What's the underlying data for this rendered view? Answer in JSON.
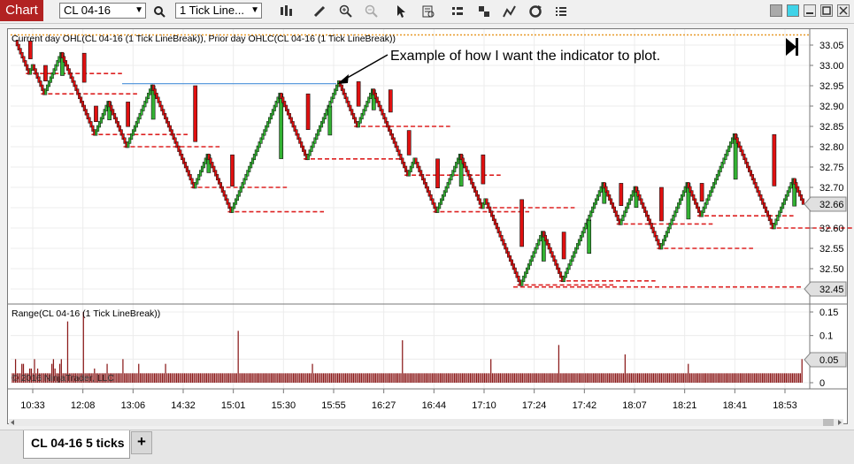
{
  "toolbar": {
    "chart_tab": "Chart",
    "instrument": "CL 04-16",
    "bar_type": "1 Tick Line...",
    "icons": [
      "search-icon",
      "bar-style-icon",
      "pencil-icon",
      "zoom-in-icon",
      "zoom-out-icon",
      "pointer-icon",
      "data-box-icon",
      "properties-icon",
      "strategies-icon",
      "indicators-icon",
      "refresh-icon",
      "menu-icon"
    ]
  },
  "price_panel": {
    "indicator_label": "Current day OHL(CL 04-16 (1 Tick LineBreak)), Prior day OHLC(CL 04-16 (1 Tick LineBreak))",
    "annotation": "Example of how I want the indicator to plot.",
    "y_ticks": [
      "33.05",
      "33.00",
      "32.95",
      "32.90",
      "32.85",
      "32.80",
      "32.75",
      "32.70",
      "32.65",
      "32.60",
      "32.55",
      "32.50",
      "32.45"
    ],
    "last_price": "32.66",
    "low_marker": "32.45"
  },
  "range_panel": {
    "label": "Range(CL 04-16 (1 Tick LineBreak))",
    "y_ticks": [
      "0.15",
      "0.1",
      "0.05",
      "0"
    ],
    "current_value": "0.05",
    "copyright": "© 2016 NinjaTrader, LLC"
  },
  "x_axis": [
    "10:33",
    "12:08",
    "13:06",
    "14:32",
    "15:01",
    "15:30",
    "15:55",
    "16:27",
    "16:44",
    "17:10",
    "17:24",
    "17:42",
    "18:07",
    "18:21",
    "18:41",
    "18:53"
  ],
  "colors": {
    "up": "#33b233",
    "down": "#e01010",
    "panel_border": "#777777",
    "low_line": "#dd2222",
    "annot_line": "#4a90d9",
    "prior_dotted": "#e89a2a",
    "range_bars": "#8b1a1a",
    "chart_tab": "#b22222"
  },
  "tabs": {
    "active": "CL 04-16 5 ticks",
    "add": "+"
  },
  "chart_data": {
    "type": "line-break",
    "price_path": [
      33.06,
      32.98,
      33.0,
      32.93,
      33.03,
      32.9,
      32.83,
      32.91,
      32.8,
      32.95,
      32.7,
      32.78,
      32.64,
      32.93,
      32.77,
      32.9,
      32.96,
      32.85,
      32.94,
      32.84,
      32.73,
      32.77,
      32.64,
      32.78,
      32.65,
      32.67,
      32.46,
      32.59,
      32.47,
      32.62,
      32.71,
      32.61,
      32.7,
      32.55,
      32.71,
      32.63,
      32.83,
      32.6,
      32.72,
      32.66
    ],
    "range_values": [
      0.02,
      0.02,
      0.05,
      0.02,
      0.02,
      0.02,
      0.04,
      0.04,
      0.02,
      0.02,
      0.02,
      0.03,
      0.03,
      0.02,
      0.05,
      0.02,
      0.03,
      0.02,
      0.02,
      0.02,
      0.02,
      0.02,
      0.02,
      0.02,
      0.02,
      0.04,
      0.05,
      0.03,
      0.02,
      0.02,
      0.04,
      0.05,
      0.02,
      0.02,
      0.02,
      0.13,
      0.02,
      0.02,
      0.02,
      0.02,
      0.02,
      0.02,
      0.02,
      0.02,
      0.02,
      0.15,
      0.02,
      0.02,
      0.02,
      0.02,
      0.02,
      0.02,
      0.03,
      0.02,
      0.02,
      0.02,
      0.02,
      0.02,
      0.02,
      0.02,
      0.04,
      0.02,
      0.02,
      0.02,
      0.02,
      0.02,
      0.02,
      0.02,
      0.02,
      0.02,
      0.05,
      0.02,
      0.02,
      0.02,
      0.02,
      0.02,
      0.02,
      0.02,
      0.02,
      0.02,
      0.04,
      0.02,
      0.02,
      0.02,
      0.02,
      0.02,
      0.02,
      0.02,
      0.02,
      0.02,
      0.02,
      0.02,
      0.02,
      0.02,
      0.02,
      0.02,
      0.02,
      0.04,
      0.02,
      0.02,
      0.02,
      0.02,
      0.02,
      0.02,
      0.02,
      0.02,
      0.02,
      0.02,
      0.02,
      0.02,
      0.02,
      0.02,
      0.02,
      0.02,
      0.02,
      0.02,
      0.02,
      0.02,
      0.02,
      0.02,
      0.02,
      0.02,
      0.02,
      0.02,
      0.02,
      0.02,
      0.02,
      0.02,
      0.02,
      0.02,
      0.02,
      0.02,
      0.02,
      0.02,
      0.02,
      0.02,
      0.02,
      0.02,
      0.02,
      0.02,
      0.02,
      0.02,
      0.02,
      0.11,
      0.02,
      0.02,
      0.02,
      0.02,
      0.02,
      0.02,
      0.02,
      0.02,
      0.02,
      0.02,
      0.02,
      0.02,
      0.02,
      0.02,
      0.02,
      0.02,
      0.02,
      0.02,
      0.02,
      0.02,
      0.02,
      0.02,
      0.02,
      0.02,
      0.02,
      0.02,
      0.02,
      0.02,
      0.02,
      0.02,
      0.02,
      0.02,
      0.02,
      0.02,
      0.02,
      0.02,
      0.02,
      0.02,
      0.02,
      0.02,
      0.02,
      0.02,
      0.02,
      0.02,
      0.02,
      0.02,
      0.04,
      0.02,
      0.02,
      0.02,
      0.02,
      0.02,
      0.02,
      0.02,
      0.02,
      0.02,
      0.02,
      0.02,
      0.02,
      0.02,
      0.02,
      0.02,
      0.02,
      0.02,
      0.02,
      0.02,
      0.02,
      0.02,
      0.02,
      0.02,
      0.02,
      0.02,
      0.02,
      0.02,
      0.02,
      0.02,
      0.02,
      0.02,
      0.02,
      0.02,
      0.02,
      0.02,
      0.02,
      0.02,
      0.02,
      0.02,
      0.02,
      0.02,
      0.02,
      0.02,
      0.02,
      0.02,
      0.02,
      0.02,
      0.02,
      0.02,
      0.02,
      0.02,
      0.02,
      0.02,
      0.02,
      0.02,
      0.02,
      0.09,
      0.02,
      0.02,
      0.02,
      0.02,
      0.02,
      0.02,
      0.02,
      0.02,
      0.02,
      0.02,
      0.02,
      0.02,
      0.02,
      0.02,
      0.02,
      0.02,
      0.02,
      0.02,
      0.02,
      0.02,
      0.02,
      0.02,
      0.02,
      0.02,
      0.02,
      0.02,
      0.02,
      0.02,
      0.02,
      0.02,
      0.02,
      0.02,
      0.02,
      0.02,
      0.02,
      0.02,
      0.02,
      0.02,
      0.02,
      0.02,
      0.02,
      0.02,
      0.02,
      0.02,
      0.02,
      0.02,
      0.02,
      0.02,
      0.02,
      0.02,
      0.02,
      0.02,
      0.02,
      0.02,
      0.02,
      0.05,
      0.02,
      0.02,
      0.02,
      0.02,
      0.02,
      0.02,
      0.02,
      0.02,
      0.02,
      0.02,
      0.02,
      0.02,
      0.02,
      0.02,
      0.02,
      0.02,
      0.02,
      0.02,
      0.02,
      0.02,
      0.02,
      0.02,
      0.02,
      0.02,
      0.02,
      0.02,
      0.02,
      0.02,
      0.02,
      0.02,
      0.02,
      0.02,
      0.02,
      0.02,
      0.02,
      0.02,
      0.02,
      0.02,
      0.02,
      0.02,
      0.02,
      0.02,
      0.08,
      0.02,
      0.02,
      0.02,
      0.02,
      0.02,
      0.02,
      0.02,
      0.02,
      0.02,
      0.02,
      0.02,
      0.02,
      0.02,
      0.02,
      0.02,
      0.02,
      0.02,
      0.02,
      0.02,
      0.02,
      0.02,
      0.02,
      0.02,
      0.02,
      0.02,
      0.02,
      0.02,
      0.02,
      0.02,
      0.02,
      0.02,
      0.02,
      0.02,
      0.02,
      0.02,
      0.02,
      0.02,
      0.02,
      0.02,
      0.02,
      0.02,
      0.06,
      0.02,
      0.02,
      0.02,
      0.02,
      0.02,
      0.02,
      0.02,
      0.02,
      0.02,
      0.02,
      0.02,
      0.02,
      0.02,
      0.02,
      0.02,
      0.02,
      0.02,
      0.02,
      0.02,
      0.02,
      0.02,
      0.02,
      0.02,
      0.02,
      0.02,
      0.02,
      0.02,
      0.02,
      0.02,
      0.02,
      0.02,
      0.02,
      0.02,
      0.02,
      0.02,
      0.02,
      0.02,
      0.02,
      0.02,
      0.04,
      0.02,
      0.02,
      0.02,
      0.02,
      0.02,
      0.02,
      0.02,
      0.02,
      0.02,
      0.02,
      0.02,
      0.02,
      0.02,
      0.02,
      0.02,
      0.02,
      0.02,
      0.02,
      0.02,
      0.02,
      0.02,
      0.02,
      0.02,
      0.02,
      0.02,
      0.02,
      0.02,
      0.02,
      0.02,
      0.02,
      0.02,
      0.02,
      0.02,
      0.02,
      0.02,
      0.02,
      0.02,
      0.02,
      0.02,
      0.02,
      0.02,
      0.02,
      0.02,
      0.02,
      0.02,
      0.02,
      0.02,
      0.02,
      0.02,
      0.02,
      0.02,
      0.02,
      0.02,
      0.02,
      0.02,
      0.02,
      0.02,
      0.02,
      0.02,
      0.02,
      0.02,
      0.02,
      0.02,
      0.02,
      0.02,
      0.02,
      0.02,
      0.02,
      0.02,
      0.02,
      0.02,
      0.05
    ],
    "prior_day_close": 33.075,
    "annotation_level": 32.955,
    "price_ylim": [
      32.43,
      33.07
    ],
    "range_ylim": [
      0,
      0.16
    ]
  }
}
